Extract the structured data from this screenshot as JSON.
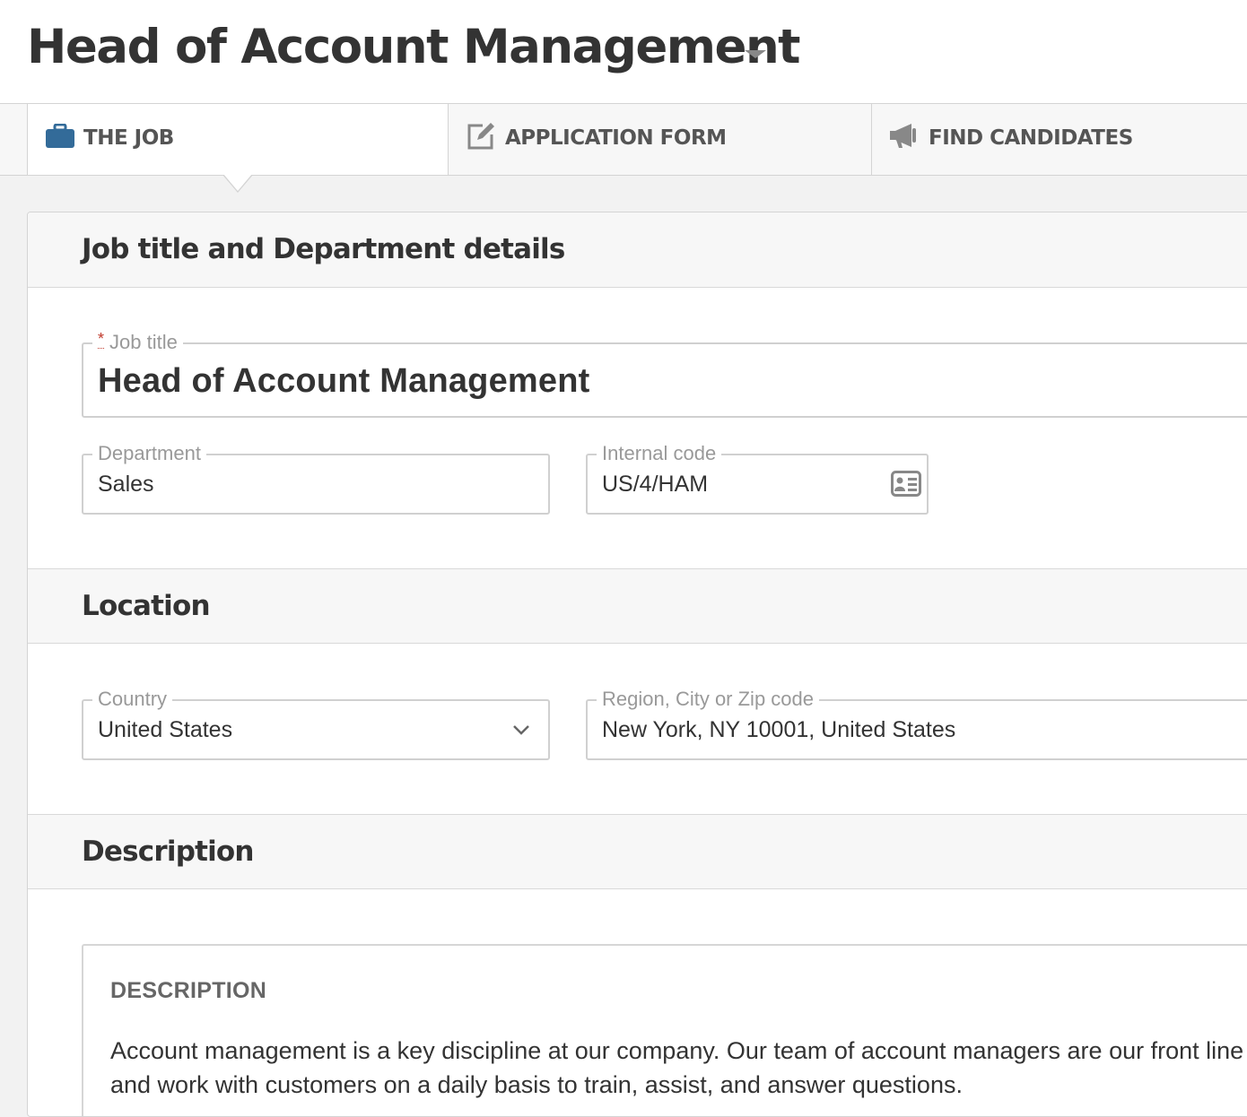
{
  "header": {
    "title": "Head of Account Management"
  },
  "tabs": [
    {
      "label": "THE JOB",
      "icon": "briefcase-icon",
      "active": true
    },
    {
      "label": "APPLICATION FORM",
      "icon": "edit-form-icon",
      "active": false
    },
    {
      "label": "FIND CANDIDATES",
      "icon": "megaphone-icon",
      "active": false
    }
  ],
  "colors": {
    "accent": "#336b99",
    "border": "#d4d4d4",
    "required": "#c0392b"
  },
  "sections": {
    "job": {
      "title": "Job title and Department details",
      "job_title": {
        "required_mark": "*",
        "label": "Job title",
        "value": "Head of Account Management"
      },
      "department": {
        "label": "Department",
        "value": "Sales"
      },
      "internal_code": {
        "label": "Internal code",
        "value": "US/4/HAM",
        "icon": "id-card-icon"
      }
    },
    "location": {
      "title": "Location",
      "country": {
        "label": "Country",
        "value": "United States"
      },
      "region": {
        "label": "Region, City or Zip code",
        "value": "New York, NY 10001, United States"
      }
    },
    "description": {
      "title": "Description",
      "heading": "DESCRIPTION",
      "text": "Account management is a key discipline at our company. Our team of account managers are our front line and work with customers on a daily basis to train, assist, and answer questions."
    }
  }
}
